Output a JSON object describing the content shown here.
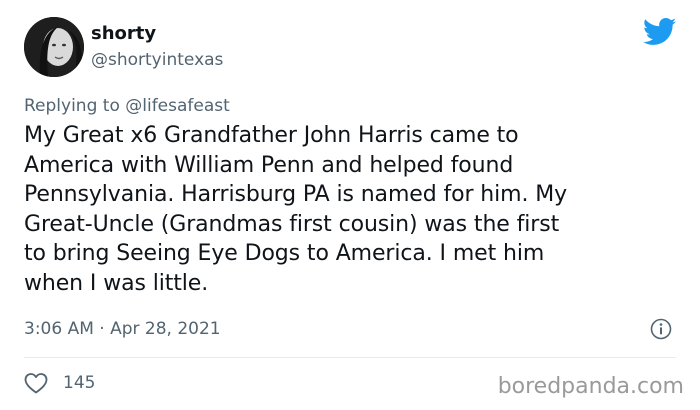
{
  "author": {
    "name": "shorty",
    "handle": "@shortyintexas",
    "avatar_icon": "profile-photo"
  },
  "platform_icon": "twitter-bird-icon",
  "reply": {
    "prefix": "Replying to",
    "to": "@lifesafeast"
  },
  "tweet": {
    "lines": [
      "My Great x6 Grandfather John Harris came to",
      "America with William Penn and helped found",
      "Pennsylvania. Harrisburg PA is named for him. My",
      "Great-Uncle (Grandmas first cousin) was the first",
      "to bring Seeing Eye Dogs to America. I met him",
      "when I was little."
    ],
    "timestamp": "3:06 AM · Apr 28, 2021"
  },
  "actions": {
    "like_count": "145",
    "like_icon": "heart-icon",
    "info_icon": "info-icon"
  },
  "watermark": "boredpanda.com",
  "colors": {
    "twitter_blue": "#1d9bf0",
    "secondary_text": "#536471",
    "watermark": "#9a9a9a"
  }
}
